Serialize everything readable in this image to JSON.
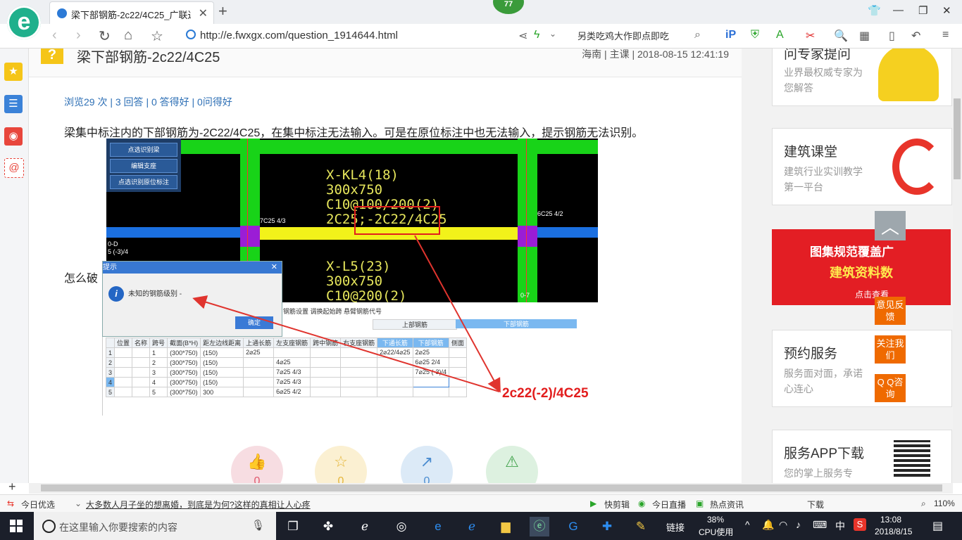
{
  "browser": {
    "tab_title": "梁下部钢筋-2c22/4C25_广联达服",
    "notif_count": "77",
    "url": "http://e.fwxgx.com/question_1914644.html",
    "search_box": "另类吃鸡大作即点即吃"
  },
  "question": {
    "title": "梁下部钢筋-2c22/4C25",
    "meta": "海南 | 主课 | 2018-08-15 12:41:19",
    "stats": "浏览29 次 | 3 回答 | 0 答得好 | 0问得好",
    "body_line1": "梁集中标注内的下部钢筋为-2C22/4C25，在集中标注无法输入。可是在原位标注中也无法输入，提示钢筋无法识别。",
    "body_line2": "怎么破"
  },
  "cad": {
    "menu": [
      "点选识别梁",
      "编辑支座",
      "点选识别原位标注"
    ],
    "beam1": [
      "X-KL4(18)",
      "300x750",
      "C10@100/200(2)",
      "2C25;-2C22/4C25"
    ],
    "beam2": [
      "X-L5(23)",
      "300x750",
      "C10@200(2)"
    ],
    "label_left": "7C25 4/3",
    "label_right": "6C25 4/2",
    "label_edge1": "0-D",
    "label_edge2": "5 (-3)/4",
    "label_bottom": "0-7"
  },
  "dialog": {
    "title": "提示",
    "message": "未知的钢筋级别 -",
    "ok": "确定"
  },
  "table": {
    "tools": "钢筋设置   调换起始跨   悬臂钢筋代号",
    "group_upper": "上部钢筋",
    "group_lower": "下部钢筋",
    "headers": [
      "",
      "位置",
      "名称",
      "跨号",
      "截面(B*H)",
      "距左边线距离",
      "上通长筋",
      "左支座钢筋",
      "跨中钢筋",
      "右支座钢筋",
      "下通长筋",
      "下部钢筋",
      "侧面"
    ],
    "rows": [
      [
        "1",
        "",
        "",
        "1",
        "(300*750)",
        "(150)",
        "2⌀25",
        "",
        "",
        "",
        "2⌀22/4⌀25",
        "2⌀25",
        ""
      ],
      [
        "2",
        "",
        "",
        "2",
        "(300*750)",
        "(150)",
        "",
        "4⌀25",
        "",
        "",
        "",
        "6⌀25 2/4",
        ""
      ],
      [
        "3",
        "",
        "",
        "3",
        "(300*750)",
        "(150)",
        "",
        "7⌀25 4/3",
        "",
        "",
        "",
        "7⌀25 (-3)/4",
        ""
      ],
      [
        "4",
        "",
        "",
        "4",
        "(300*750)",
        "(150)",
        "",
        "7⌀25 4/3",
        "",
        "",
        "",
        "",
        ""
      ],
      [
        "5",
        "",
        "",
        "5",
        "(300*750)",
        "300",
        "",
        "6⌀25 4/2",
        "",
        "",
        "",
        "",
        ""
      ]
    ],
    "annotation": "2c22(-2)/4C25"
  },
  "actions": [
    {
      "icon": "👍",
      "count": "0",
      "color": "#f7dde2",
      "fg": "#e0586d"
    },
    {
      "icon": "☆",
      "count": "0",
      "color": "#fbf0d2",
      "fg": "#e5b63a"
    },
    {
      "icon": "↗",
      "count": "0",
      "color": "#dceaf7",
      "fg": "#4a8cd0"
    },
    {
      "icon": "⚠",
      "count": "",
      "color": "#ddf1e0",
      "fg": "#42a34d"
    }
  ],
  "sidebar": {
    "expert_title": "问专家提问",
    "expert_desc": "业界最权威专家为您解答",
    "class_title": "建筑课堂",
    "class_desc": "建筑行业实训教学第一平台",
    "promo_1": "图集规范覆盖广",
    "promo_2": "建筑资料数",
    "promo_3": "点击查看",
    "booking_title": "预约服务",
    "booking_desc": "服务面对面，承诺心连心",
    "app_title": "服务APP下载",
    "app_desc": "您的掌上服务专"
  },
  "float": {
    "feedback": "意见反馈",
    "follow": "关注我们",
    "qq": "Q Q咨询"
  },
  "statusbar": {
    "today": "今日优选",
    "news": "大多数人月子坐的想离婚，到底是为何?这样的真相让人心疼",
    "kuaijian": "快剪辑",
    "zhibo": "今日直播",
    "redian": "热点资讯",
    "download": "下载",
    "zoom": "110%"
  },
  "taskbar": {
    "search_placeholder": "在这里输入你要搜索的内容",
    "link": "链接",
    "cpu_pct": "38%",
    "cpu_label": "CPU使用",
    "ime": "中",
    "time": "13:08",
    "date": "2018/8/15"
  }
}
